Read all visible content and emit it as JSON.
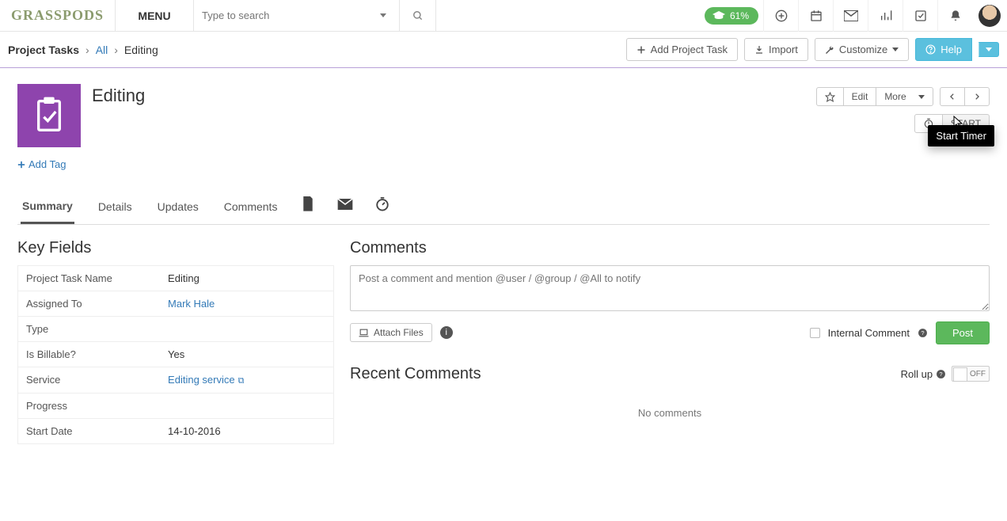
{
  "nav": {
    "brand": "GRASSPODS",
    "menu": "MENU",
    "search_placeholder": "Type to search",
    "progress_badge": "61%"
  },
  "bar2": {
    "root": "Project Tasks",
    "all": "All",
    "current": "Editing",
    "add": "Add Project Task",
    "import": "Import",
    "customize": "Customize",
    "help": "Help"
  },
  "record": {
    "title": "Editing",
    "add_tag": "Add Tag",
    "edit": "Edit",
    "more": "More",
    "start": "START",
    "tooltip": "Start Timer"
  },
  "tabs": {
    "summary": "Summary",
    "details": "Details",
    "updates": "Updates",
    "comments": "Comments"
  },
  "key_fields": {
    "title": "Key Fields",
    "rows": {
      "name_label": "Project Task Name",
      "name_value": "Editing",
      "assigned_label": "Assigned To",
      "assigned_value": "Mark Hale",
      "type_label": "Type",
      "type_value": "",
      "billable_label": "Is Billable?",
      "billable_value": "Yes",
      "service_label": "Service",
      "service_value": "Editing service",
      "progress_label": "Progress",
      "progress_value": "",
      "start_label": "Start Date",
      "start_value": "14-10-2016"
    }
  },
  "comments": {
    "title": "Comments",
    "placeholder": "Post a comment and mention @user / @group / @All to notify",
    "attach": "Attach Files",
    "internal": "Internal Comment",
    "post": "Post",
    "recent_title": "Recent Comments",
    "rollup": "Roll up",
    "toggle": "OFF",
    "empty": "No comments"
  }
}
